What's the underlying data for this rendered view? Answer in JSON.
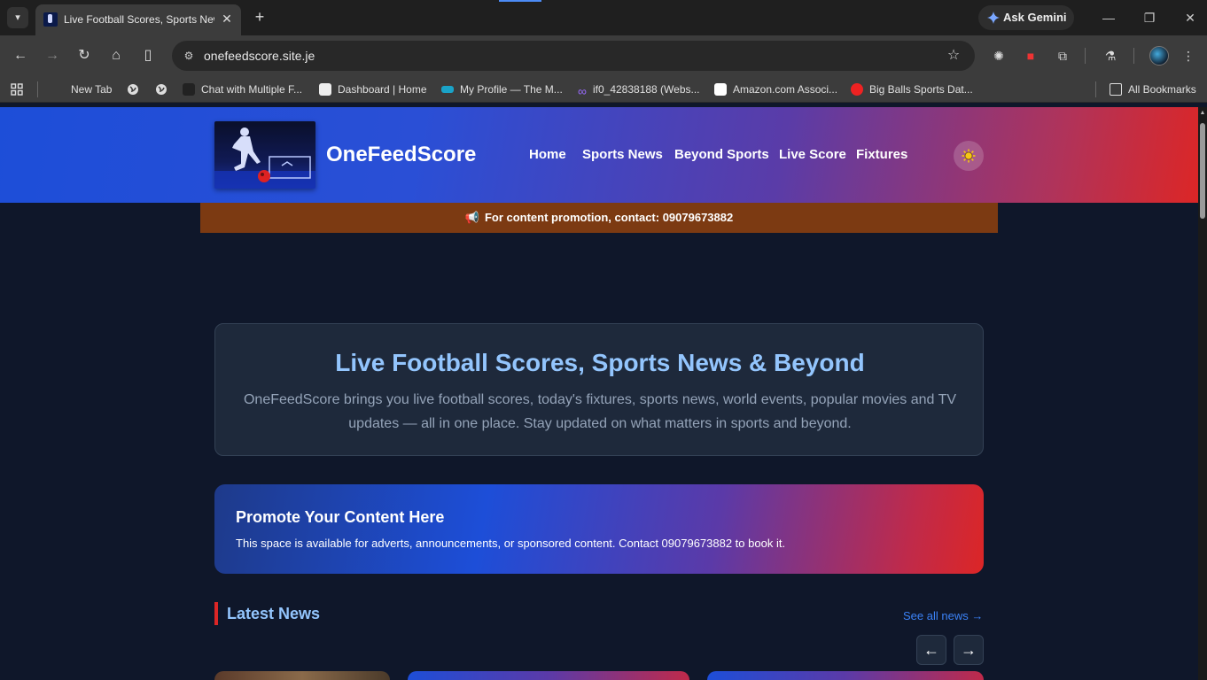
{
  "browser": {
    "tab_title": "Live Football Scores, Sports News",
    "url": "onefeedscore.site.je",
    "gemini_label": "Ask Gemini",
    "bookmarks": [
      {
        "label": "New Tab"
      },
      {
        "label": "Chat with Multiple F..."
      },
      {
        "label": "Dashboard | Home"
      },
      {
        "label": "My Profile — The M..."
      },
      {
        "label": "if0_42838188 (Webs..."
      },
      {
        "label": "Amazon.com Associ..."
      },
      {
        "label": "Big Balls Sports Dat..."
      }
    ],
    "all_bookmarks": "All Bookmarks"
  },
  "header": {
    "brand": "OneFeedScore",
    "nav": [
      "Home",
      "Sports News",
      "Beyond Sports",
      "Live Score",
      "Fixtures"
    ]
  },
  "promo_bar": {
    "text": "For content promotion, contact: 09079673882"
  },
  "hero": {
    "title": "Live Football Scores, Sports News & Beyond",
    "text": "OneFeedScore brings you live football scores, today's fixtures, sports news, world events, popular movies and TV updates — all in one place. Stay updated on what matters in sports and beyond."
  },
  "promote": {
    "title": "Promote Your Content Here",
    "text": "This space is available for adverts, announcements, or sponsored content. Contact 09079673882 to book it."
  },
  "latest_news": {
    "title": "Latest News",
    "see_all": "See all news →",
    "prev": "←",
    "next": "→"
  },
  "colors": {
    "accent": "#93c5fd",
    "link": "#3b82f6",
    "red": "#dc2626",
    "promo_bar": "#7c3a12"
  }
}
